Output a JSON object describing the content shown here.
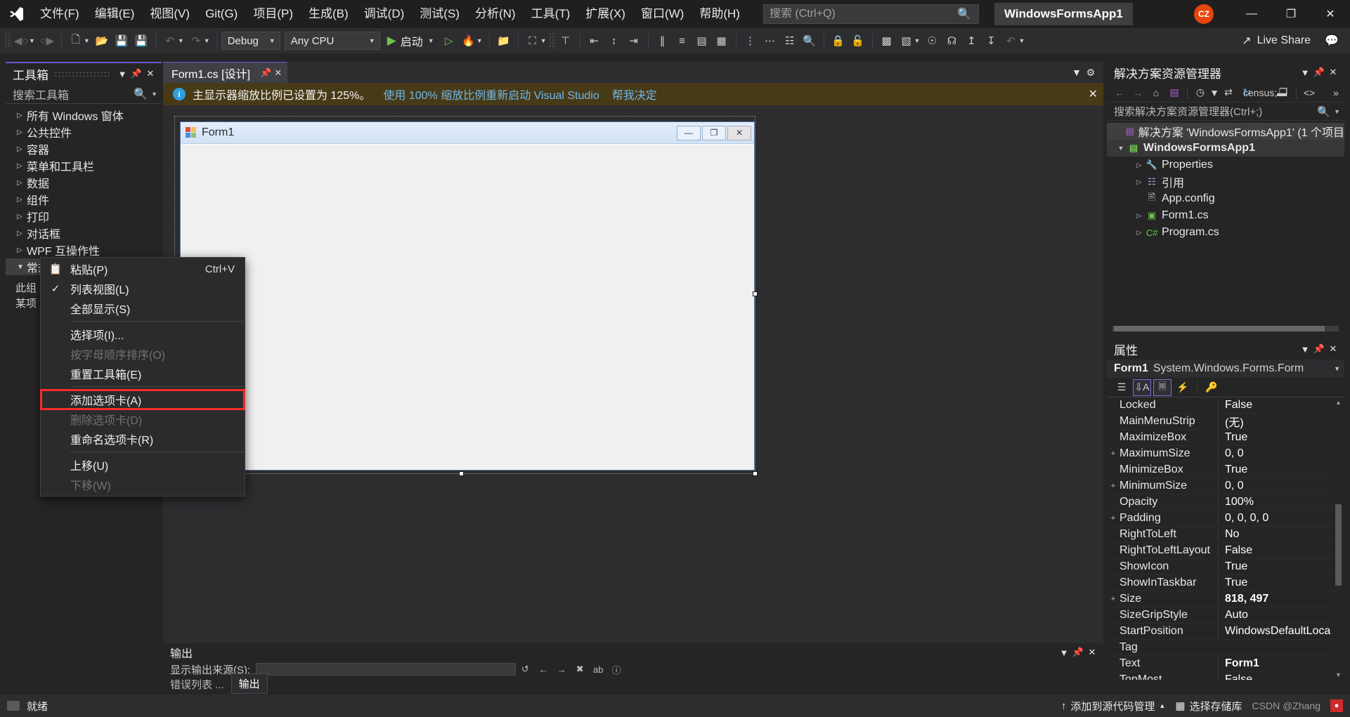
{
  "titlebar": {
    "logo": "visual-studio-logo",
    "menus": [
      "文件(F)",
      "编辑(E)",
      "视图(V)",
      "Git(G)",
      "项目(P)",
      "生成(B)",
      "调试(D)",
      "测试(S)",
      "分析(N)",
      "工具(T)",
      "扩展(X)",
      "窗口(W)",
      "帮助(H)"
    ],
    "search_placeholder": "搜索 (Ctrl+Q)",
    "project_chip": "WindowsFormsApp1",
    "avatar_initials": "CZ",
    "minimize": "—",
    "restore": "❐",
    "close": "✕"
  },
  "toolbar": {
    "config": "Debug",
    "platform": "Any CPU",
    "run_label": "启动",
    "live_share": "Live Share"
  },
  "toolbox": {
    "title": "工具箱",
    "search_placeholder": "搜索工具箱",
    "items": [
      {
        "label": "所有 Windows 窗体",
        "open": false
      },
      {
        "label": "公共控件",
        "open": false
      },
      {
        "label": "容器",
        "open": false
      },
      {
        "label": "菜单和工具栏",
        "open": false
      },
      {
        "label": "数据",
        "open": false
      },
      {
        "label": "组件",
        "open": false
      },
      {
        "label": "打印",
        "open": false
      },
      {
        "label": "对话框",
        "open": false
      },
      {
        "label": "WPF 互操作性",
        "open": false
      },
      {
        "label": "常规",
        "open": true
      }
    ],
    "note_line1": "此组",
    "note_line2": "某项"
  },
  "context_menu": {
    "items": [
      {
        "label": "粘贴(P)",
        "accel": "Ctrl+V",
        "icon": "paste-icon",
        "checked": false,
        "disabled": false,
        "highlighted": false,
        "separator_after": false
      },
      {
        "label": "列表视图(L)",
        "accel": "",
        "icon": "",
        "checked": true,
        "disabled": false,
        "highlighted": false,
        "separator_after": false
      },
      {
        "label": "全部显示(S)",
        "accel": "",
        "icon": "",
        "checked": false,
        "disabled": false,
        "highlighted": false,
        "separator_after": true
      },
      {
        "label": "选择项(I)...",
        "accel": "",
        "icon": "",
        "checked": false,
        "disabled": false,
        "highlighted": false,
        "separator_after": false
      },
      {
        "label": "按字母顺序排序(O)",
        "accel": "",
        "icon": "",
        "checked": false,
        "disabled": true,
        "highlighted": false,
        "separator_after": false
      },
      {
        "label": "重置工具箱(E)",
        "accel": "",
        "icon": "",
        "checked": false,
        "disabled": false,
        "highlighted": false,
        "separator_after": true
      },
      {
        "label": "添加选项卡(A)",
        "accel": "",
        "icon": "",
        "checked": false,
        "disabled": false,
        "highlighted": true,
        "separator_after": false
      },
      {
        "label": "删除选项卡(D)",
        "accel": "",
        "icon": "",
        "checked": false,
        "disabled": true,
        "highlighted": false,
        "separator_after": false
      },
      {
        "label": "重命名选项卡(R)",
        "accel": "",
        "icon": "",
        "checked": false,
        "disabled": false,
        "highlighted": false,
        "separator_after": true
      },
      {
        "label": "上移(U)",
        "accel": "",
        "icon": "",
        "checked": false,
        "disabled": false,
        "highlighted": false,
        "separator_after": false
      },
      {
        "label": "下移(W)",
        "accel": "",
        "icon": "",
        "checked": false,
        "disabled": true,
        "highlighted": false,
        "separator_after": false
      }
    ],
    "highlight_color": "#ff2b2b"
  },
  "editor": {
    "tab_label": "Form1.cs [设计]",
    "infobar_text": "主显示器缩放比例已设置为 125%。",
    "infobar_link": "使用 100% 缩放比例重新启动 Visual Studio",
    "infobar_link2": "帮我决定",
    "form_title": "Form1",
    "form_minimize": "—",
    "form_maximize": "❐",
    "form_close": "✕"
  },
  "output": {
    "title": "输出",
    "source_label": "显示输出来源(S):",
    "tabs": [
      {
        "label": "错误列表 ...",
        "active": false
      },
      {
        "label": "输出",
        "active": true
      }
    ]
  },
  "solution_explorer": {
    "title": "解决方案资源管理器",
    "search_placeholder": "搜索解决方案资源管理器(Ctrl+;)",
    "tree": [
      {
        "label": "解决方案 'WindowsFormsApp1' (1 个项目",
        "depth": 0,
        "tri": "",
        "icon": "solution-icon",
        "style": "sel"
      },
      {
        "label": "WindowsFormsApp1",
        "depth": 0,
        "tri": "open",
        "icon": "csharp-project-icon",
        "style": "proj"
      },
      {
        "label": "Properties",
        "depth": 1,
        "tri": "closed",
        "icon": "wrench-icon",
        "style": ""
      },
      {
        "label": "引用",
        "depth": 1,
        "tri": "closed",
        "icon": "references-icon",
        "style": ""
      },
      {
        "label": "App.config",
        "depth": 1,
        "tri": "",
        "icon": "config-file-icon",
        "style": ""
      },
      {
        "label": "Form1.cs",
        "depth": 1,
        "tri": "closed",
        "icon": "form-file-icon",
        "style": ""
      },
      {
        "label": "Program.cs",
        "depth": 1,
        "tri": "closed",
        "icon": "csharp-file-icon",
        "style": ""
      }
    ]
  },
  "properties": {
    "title": "属性",
    "object_name": "Form1",
    "object_type": "System.Windows.Forms.Form",
    "rows": [
      {
        "expander": "",
        "name": "Locked",
        "value": "False",
        "bold": false
      },
      {
        "expander": "",
        "name": "MainMenuStrip",
        "value": "(无)",
        "bold": false
      },
      {
        "expander": "",
        "name": "MaximizeBox",
        "value": "True",
        "bold": false
      },
      {
        "expander": "+",
        "name": "MaximumSize",
        "value": "0, 0",
        "bold": false
      },
      {
        "expander": "",
        "name": "MinimizeBox",
        "value": "True",
        "bold": false
      },
      {
        "expander": "+",
        "name": "MinimumSize",
        "value": "0, 0",
        "bold": false
      },
      {
        "expander": "",
        "name": "Opacity",
        "value": "100%",
        "bold": false
      },
      {
        "expander": "+",
        "name": "Padding",
        "value": "0, 0, 0, 0",
        "bold": false
      },
      {
        "expander": "",
        "name": "RightToLeft",
        "value": "No",
        "bold": false
      },
      {
        "expander": "",
        "name": "RightToLeftLayout",
        "value": "False",
        "bold": false
      },
      {
        "expander": "",
        "name": "ShowIcon",
        "value": "True",
        "bold": false
      },
      {
        "expander": "",
        "name": "ShowInTaskbar",
        "value": "True",
        "bold": false
      },
      {
        "expander": "+",
        "name": "Size",
        "value": "818, 497",
        "bold": true
      },
      {
        "expander": "",
        "name": "SizeGripStyle",
        "value": "Auto",
        "bold": false
      },
      {
        "expander": "",
        "name": "StartPosition",
        "value": "WindowsDefaultLoca",
        "bold": false
      },
      {
        "expander": "",
        "name": "Tag",
        "value": "",
        "bold": false
      },
      {
        "expander": "",
        "name": "Text",
        "value": "Form1",
        "bold": true
      },
      {
        "expander": "",
        "name": "TopMost",
        "value": "False",
        "bold": false
      }
    ]
  },
  "statusbar": {
    "ready": "就绪",
    "source_control": "添加到源代码管理",
    "repo": "选择存储库",
    "watermark": "CSDN @Zhang"
  }
}
